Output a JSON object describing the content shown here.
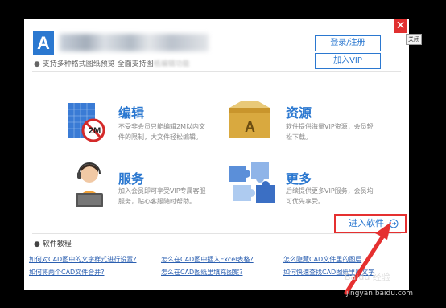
{
  "header": {
    "logo_letter": "A",
    "title": "",
    "login_button": "登录/注册",
    "vip_button": "加入VIP",
    "tagline": "支持多种格式图纸预览 全面支持图",
    "tagline_blurred": "纸编辑功能"
  },
  "features": [
    {
      "title": "编辑",
      "desc": "不受非会员只能编辑2M以内文件的限制，大文件轻松编辑。",
      "icon_text": "2M"
    },
    {
      "title": "资源",
      "desc": "软件提供海量VIP资源，会员轻松下载。",
      "icon_text": "A"
    },
    {
      "title": "服务",
      "desc": "加入会员即可享受VIP专属客服服务，贴心客服随时帮助。"
    },
    {
      "title": "更多",
      "desc": "后续提供更多VIP服务，会员均可优先享受。"
    }
  ],
  "enter_button": {
    "label": "进入软件"
  },
  "tutorials": {
    "label": "软件教程",
    "links": [
      "如何对CAD图中的文字样式进行设置?",
      "怎么在CAD图中插入Excel表格?",
      "怎么隐藏CAD文件里的图层",
      "如何将两个CAD文件合并?",
      "怎么在CAD图纸里填充图案?",
      "如何快速查找CAD图纸里的文字"
    ]
  },
  "close": {
    "symbol": "✕",
    "tooltip": "关闭"
  },
  "watermark": {
    "line1": "Baidu 经验",
    "line2": "jingyan.baidu.com"
  },
  "colors": {
    "accent": "#2b78d0",
    "highlight": "#e53030",
    "close": "#e03030"
  }
}
